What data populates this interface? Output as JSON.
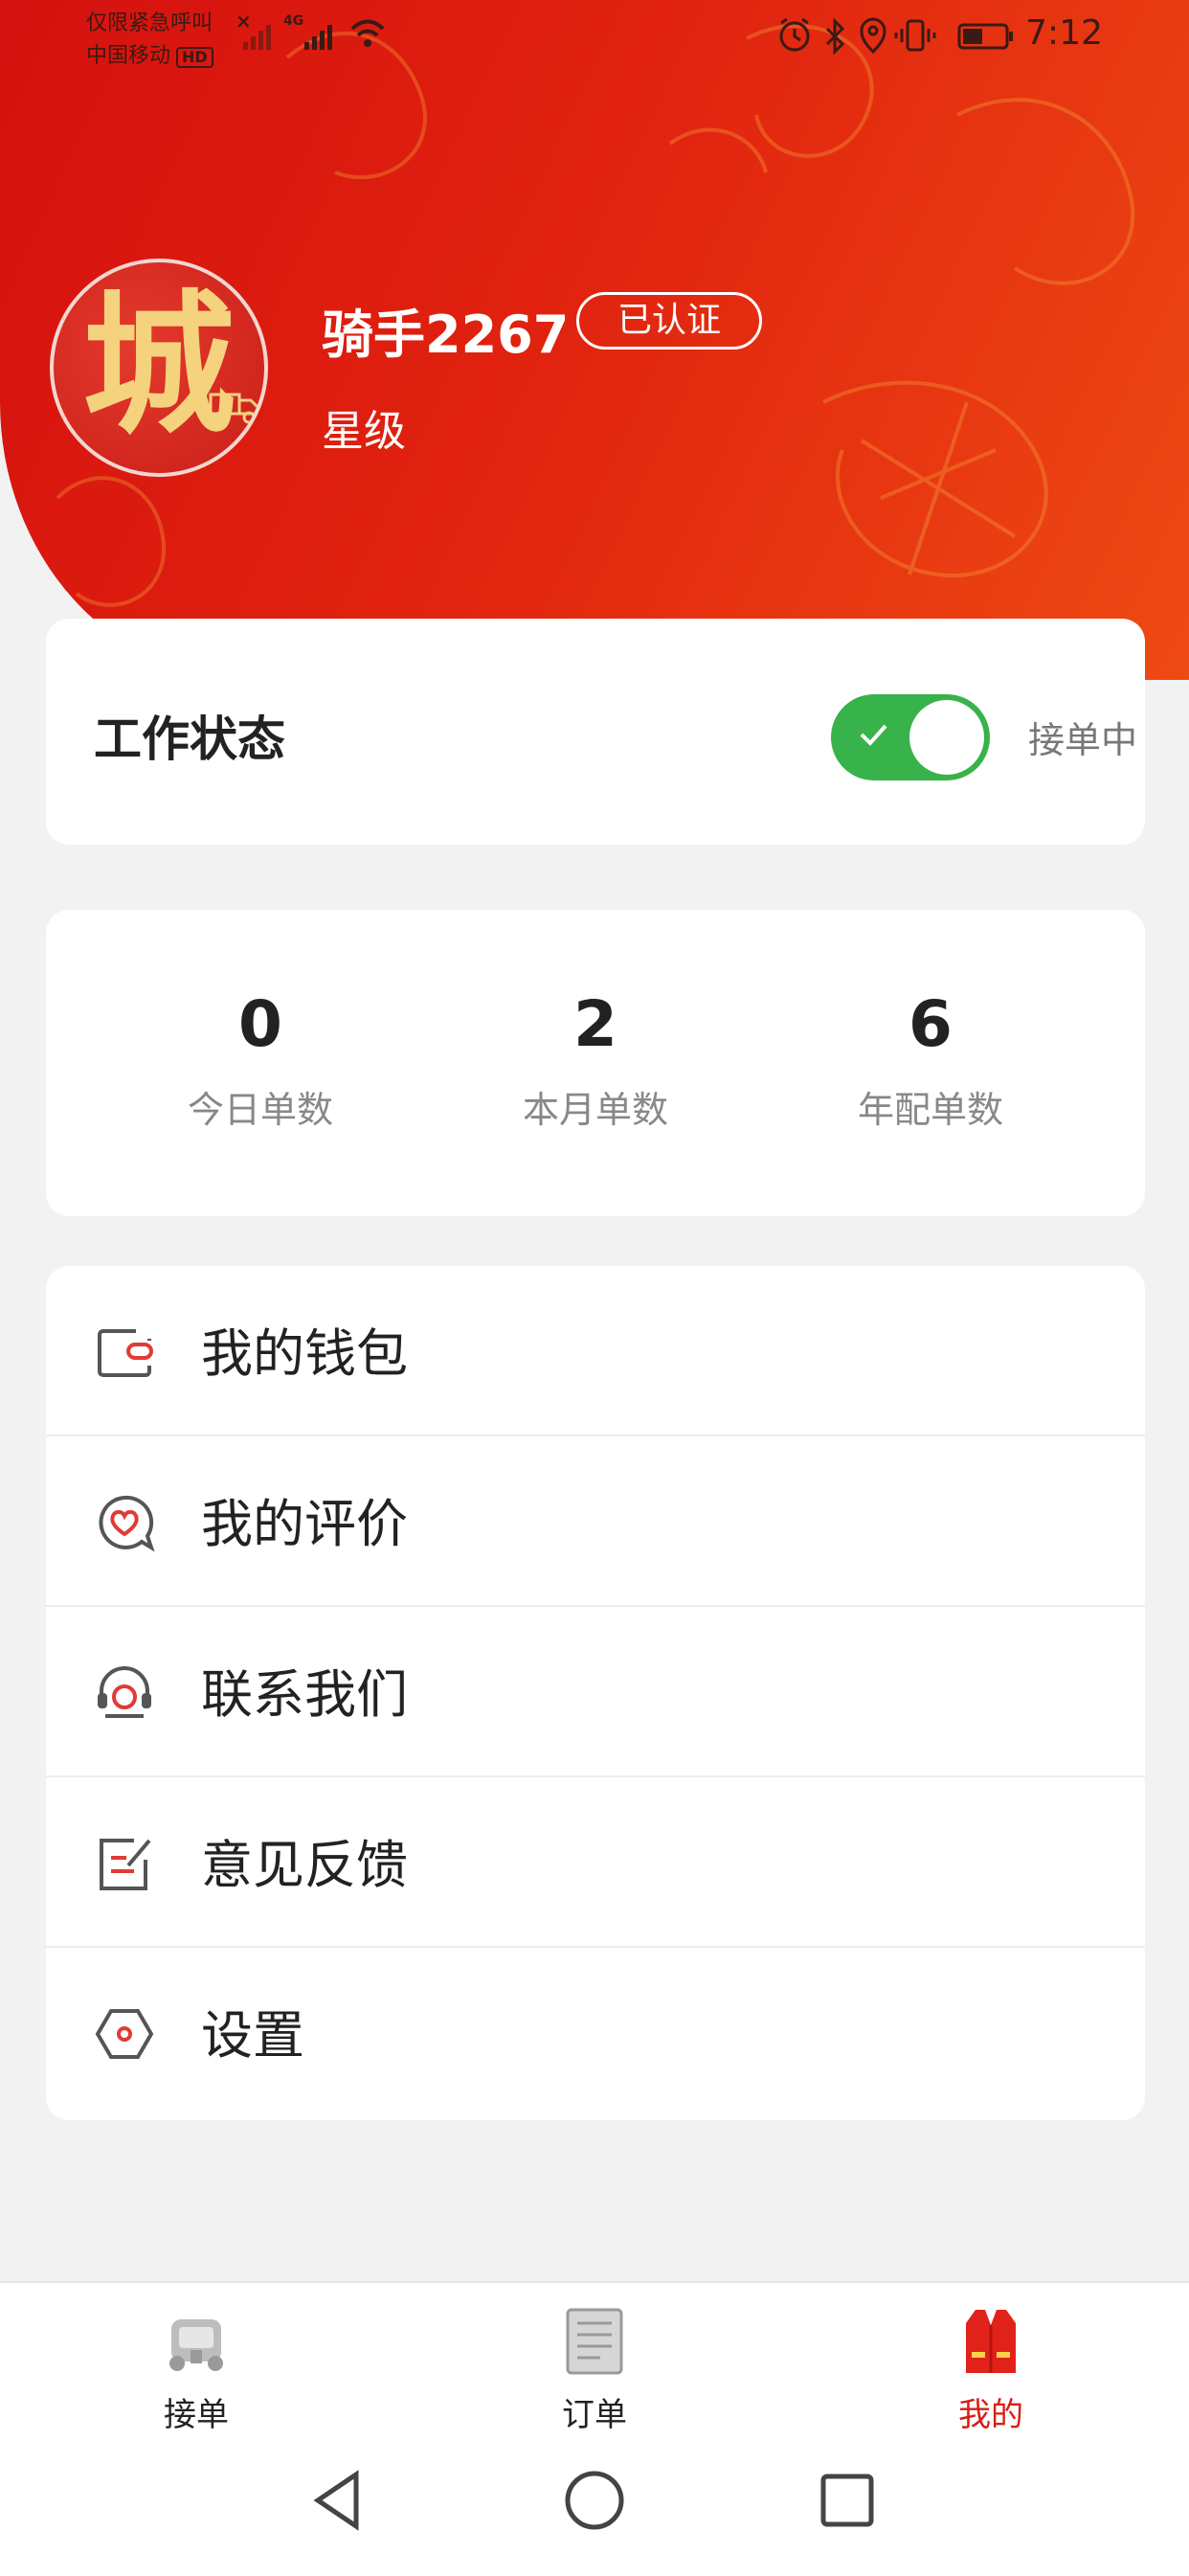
{
  "status_bar": {
    "carrier_line1": "仅限紧急呼叫",
    "carrier_line2": "中国移动",
    "hd_badge": "HD",
    "network_badge": "4G",
    "close_mark": "×",
    "time": "7:12",
    "icons": [
      "alarm-icon",
      "bluetooth-icon",
      "location-icon",
      "vibrate-icon",
      "battery-icon"
    ]
  },
  "profile": {
    "avatar_char": "城",
    "username": "骑手2267",
    "verified_label": "已认证",
    "rating_label": "星级"
  },
  "work_status": {
    "title": "工作状态",
    "toggle_on": true,
    "status_text": "接单中",
    "accent_color": "#38b24a"
  },
  "stats": [
    {
      "value": "0",
      "label": "今日单数"
    },
    {
      "value": "2",
      "label": "本月单数"
    },
    {
      "value": "6",
      "label": "年配单数"
    }
  ],
  "menu": {
    "items": [
      {
        "label": "我的钱包",
        "icon": "wallet-icon"
      },
      {
        "label": "我的评价",
        "icon": "heart-chat-icon"
      },
      {
        "label": "联系我们",
        "icon": "headset-icon"
      },
      {
        "label": "意见反馈",
        "icon": "feedback-edit-icon"
      },
      {
        "label": "设置",
        "icon": "settings-hexagon-icon"
      }
    ]
  },
  "tabbar": {
    "tabs": [
      {
        "label": "接单",
        "icon": "take-order-icon",
        "active": false
      },
      {
        "label": "订单",
        "icon": "order-list-icon",
        "active": false
      },
      {
        "label": "我的",
        "icon": "vest-profile-icon",
        "active": true
      }
    ],
    "active_color": "#d81e14"
  },
  "nav_bar": {
    "buttons": [
      "back-triangle-icon",
      "home-circle-icon",
      "recents-square-icon"
    ]
  },
  "colors": {
    "header_red": "#d5110f",
    "header_orange": "#ee4a14",
    "icon_red": "#e23a35",
    "background": "#f2f2f2"
  }
}
